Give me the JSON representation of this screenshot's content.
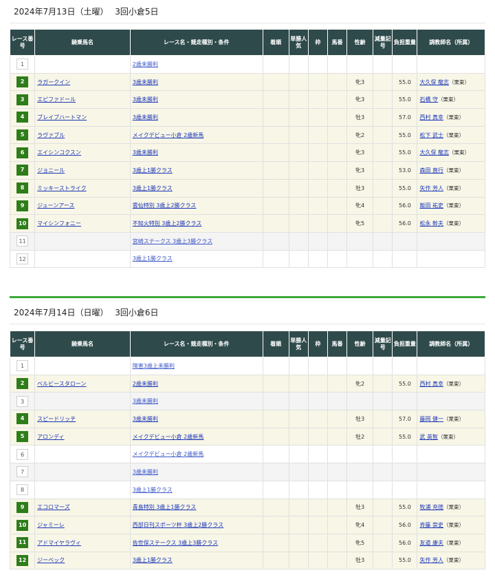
{
  "days": [
    {
      "date": "2024年7月13日（土曜）　 3回小倉5日",
      "columns": [
        "レース番号",
        "騎乗馬名",
        "レース名・競走種別・条件",
        "着順",
        "単勝人気",
        "枠",
        "馬番",
        "性齢",
        "減量記号",
        "負担重量",
        "調教師名（所属）"
      ],
      "rows": [
        {
          "num": "1",
          "horse": "",
          "race": "2歳未勝利",
          "sex": "",
          "weight": "",
          "trainer": "",
          "aff": ""
        },
        {
          "num": "2",
          "horse": "ラガークイン",
          "race": "3歳未勝利",
          "sex": "牝3",
          "weight": "55.0",
          "trainer": "大久保 龍志",
          "aff": "（栗東）"
        },
        {
          "num": "3",
          "horse": "エピファドール",
          "race": "3歳未勝利",
          "sex": "牝3",
          "weight": "55.0",
          "trainer": "石橋 守",
          "aff": "（栗東）"
        },
        {
          "num": "4",
          "horse": "ブレイブハートマン",
          "race": "3歳未勝利",
          "sex": "牡3",
          "weight": "57.0",
          "trainer": "西村 真幸",
          "aff": "（栗東）"
        },
        {
          "num": "5",
          "horse": "ラヴァブル",
          "race": "メイクデビュー小倉 2歳新馬",
          "sex": "牝2",
          "weight": "55.0",
          "trainer": "松下 武士",
          "aff": "（栗東）"
        },
        {
          "num": "6",
          "horse": "エイシンコクスン",
          "race": "3歳未勝利",
          "sex": "牝3",
          "weight": "55.0",
          "trainer": "大久保 龍志",
          "aff": "（栗東）"
        },
        {
          "num": "7",
          "horse": "ジョニール",
          "race": "3歳上1勝クラス",
          "sex": "牝3",
          "weight": "53.0",
          "trainer": "森田 直行",
          "aff": "（栗東）"
        },
        {
          "num": "8",
          "horse": "ミッキーストライク",
          "race": "3歳上1勝クラス",
          "sex": "牡3",
          "weight": "55.0",
          "trainer": "矢作 芳人",
          "aff": "（栗東）"
        },
        {
          "num": "9",
          "horse": "ジューンアース",
          "race": "雲仙特別 3歳上2勝クラス",
          "sex": "牝4",
          "weight": "56.0",
          "trainer": "飯田 祐史",
          "aff": "（栗東）"
        },
        {
          "num": "10",
          "horse": "マイシンフォニー",
          "race": "不知火特別 3歳上2勝クラス",
          "sex": "牝5",
          "weight": "56.0",
          "trainer": "松永 幹夫",
          "aff": "（栗東）"
        },
        {
          "num": "11",
          "horse": "",
          "race": "宮崎ステークス 3歳上3勝クラス",
          "sex": "",
          "weight": "",
          "trainer": "",
          "aff": ""
        },
        {
          "num": "12",
          "horse": "",
          "race": "3歳上1勝クラス",
          "sex": "",
          "weight": "",
          "trainer": "",
          "aff": ""
        }
      ]
    },
    {
      "date": "2024年7月14日（日曜）　 3回小倉6日",
      "columns": [
        "レース番号",
        "騎乗馬名",
        "レース名・競走種別・条件",
        "着順",
        "単勝人気",
        "枠",
        "馬番",
        "性齢",
        "減量記号",
        "負担重量",
        "調教師名（所属）"
      ],
      "rows": [
        {
          "num": "1",
          "horse": "",
          "race": "障害3歳上未勝利",
          "sex": "",
          "weight": "",
          "trainer": "",
          "aff": ""
        },
        {
          "num": "2",
          "horse": "ベルビースタローン",
          "race": "2歳未勝利",
          "sex": "牝2",
          "weight": "55.0",
          "trainer": "西村 真幸",
          "aff": "（栗東）"
        },
        {
          "num": "3",
          "horse": "",
          "race": "3歳未勝利",
          "sex": "",
          "weight": "",
          "trainer": "",
          "aff": ""
        },
        {
          "num": "4",
          "horse": "スピードリッチ",
          "race": "3歳未勝利",
          "sex": "牡3",
          "weight": "57.0",
          "trainer": "藤岡 健一",
          "aff": "（栗東）"
        },
        {
          "num": "5",
          "horse": "アロンディ",
          "race": "メイクデビュー小倉 2歳新馬",
          "sex": "牡2",
          "weight": "55.0",
          "trainer": "武 英智",
          "aff": "（栗東）"
        },
        {
          "num": "6",
          "horse": "",
          "race": "メイクデビュー小倉 2歳新馬",
          "sex": "",
          "weight": "",
          "trainer": "",
          "aff": ""
        },
        {
          "num": "7",
          "horse": "",
          "race": "3歳未勝利",
          "sex": "",
          "weight": "",
          "trainer": "",
          "aff": ""
        },
        {
          "num": "8",
          "horse": "",
          "race": "3歳上1勝クラス",
          "sex": "",
          "weight": "",
          "trainer": "",
          "aff": ""
        },
        {
          "num": "9",
          "horse": "エコロマーズ",
          "race": "青島特別 3歳上1勝クラス",
          "sex": "牡3",
          "weight": "55.0",
          "trainer": "牧浦 充徳",
          "aff": "（栗東）"
        },
        {
          "num": "10",
          "horse": "ジャミーレ",
          "race": "西部日刊スポーツ杯 3歳上2勝クラス",
          "sex": "牝4",
          "weight": "56.0",
          "trainer": "斉藤 崇史",
          "aff": "（栗東）"
        },
        {
          "num": "11",
          "horse": "アドマイヤラヴィ",
          "race": "佐世保ステークス 3歳上3勝クラス",
          "sex": "牝5",
          "weight": "56.0",
          "trainer": "友道 康夫",
          "aff": "（栗東）"
        },
        {
          "num": "12",
          "horse": "ジーベック",
          "race": "3歳上1勝クラス",
          "sex": "牡3",
          "weight": "55.0",
          "trainer": "矢作 芳人",
          "aff": "（栗東）"
        }
      ]
    }
  ],
  "colors": {
    "header_bg": "#2f4a4b",
    "active_num_bg": "#2e7d1a",
    "active_row_bg": "#f8f6e6",
    "link": "#1a35b8",
    "divider": "#3aaa35"
  }
}
